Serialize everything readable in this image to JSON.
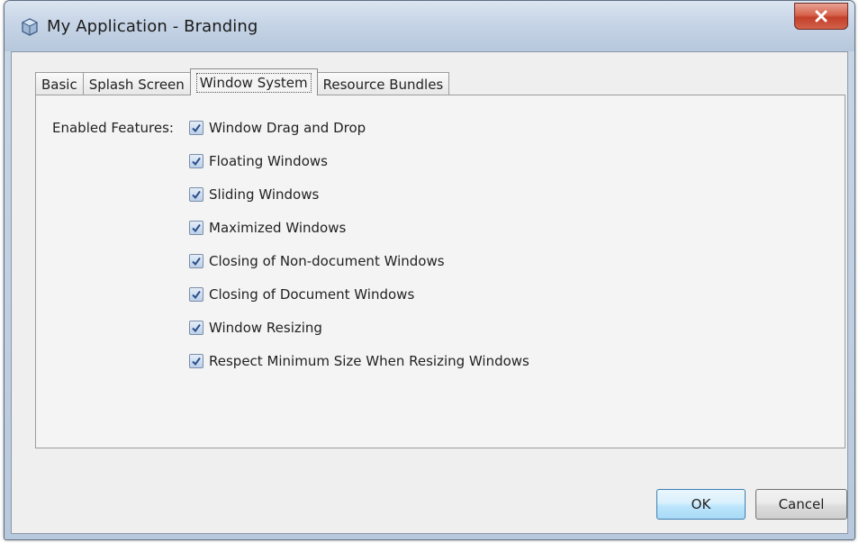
{
  "window": {
    "title": "My Application - Branding",
    "close_glyph": "X"
  },
  "tabs": [
    {
      "label": "Basic",
      "selected": false
    },
    {
      "label": "Splash Screen",
      "selected": false
    },
    {
      "label": "Window System",
      "selected": true
    },
    {
      "label": "Resource Bundles",
      "selected": false
    }
  ],
  "panel": {
    "enabled_features_label": "Enabled Features:",
    "options": [
      {
        "label": "Window Drag and Drop",
        "checked": true
      },
      {
        "label": "Floating Windows",
        "checked": true
      },
      {
        "label": "Sliding Windows",
        "checked": true
      },
      {
        "label": "Maximized Windows",
        "checked": true
      },
      {
        "label": "Closing of Non-document Windows",
        "checked": true
      },
      {
        "label": "Closing of Document Windows",
        "checked": true
      },
      {
        "label": "Window Resizing",
        "checked": true
      },
      {
        "label": "Respect Minimum Size When Resizing Windows",
        "checked": true
      }
    ]
  },
  "buttons": {
    "ok_label": "OK",
    "cancel_label": "Cancel"
  },
  "colors": {
    "checkmark": "#2b4f8a",
    "close_button": "#c3402a",
    "ok_border": "#3c7fb1"
  }
}
